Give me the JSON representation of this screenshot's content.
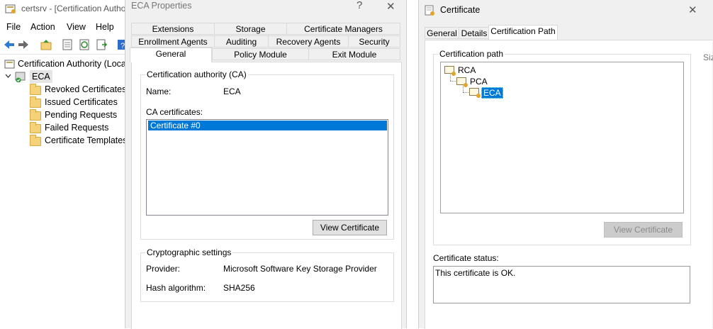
{
  "mmc": {
    "title": "certsrv - [Certification Autho",
    "menu": [
      "File",
      "Action",
      "View",
      "Help"
    ],
    "tree_root": "Certification Authority (Loca",
    "ca_node": "ECA",
    "folders": [
      "Revoked Certificates",
      "Issued Certificates",
      "Pending Requests",
      "Failed Requests",
      "Certificate Templates"
    ]
  },
  "eca_props": {
    "title": "ECA Properties",
    "help_glyph": "?",
    "close_glyph": "✕",
    "tabs_row1": [
      "Extensions",
      "Storage",
      "Certificate Managers"
    ],
    "tabs_row2": [
      "Enrollment Agents",
      "Auditing",
      "Recovery Agents",
      "Security"
    ],
    "tabs_row3": [
      "General",
      "Policy Module",
      "Exit Module"
    ],
    "ca_group_label": "Certification authority (CA)",
    "name_label": "Name:",
    "name_value": "ECA",
    "ca_certs_label": "CA certificates:",
    "ca_certs": [
      "Certificate #0"
    ],
    "view_cert_button": "View Certificate",
    "crypto_group_label": "Cryptographic settings",
    "provider_label": "Provider:",
    "provider_value": "Microsoft Software Key Storage Provider",
    "hash_label": "Hash algorithm:",
    "hash_value": "SHA256"
  },
  "cert_dialog": {
    "title": "Certificate",
    "close_glyph": "✕",
    "tabs": [
      "General",
      "Details",
      "Certification Path"
    ],
    "path_group_label": "Certification path",
    "path": [
      "RCA",
      "PCA",
      "ECA"
    ],
    "view_cert_button": "View Certificate",
    "status_label": "Certificate status:",
    "status_text": "This certificate is OK."
  },
  "edge": {
    "col_header_fragment": "Siz"
  }
}
